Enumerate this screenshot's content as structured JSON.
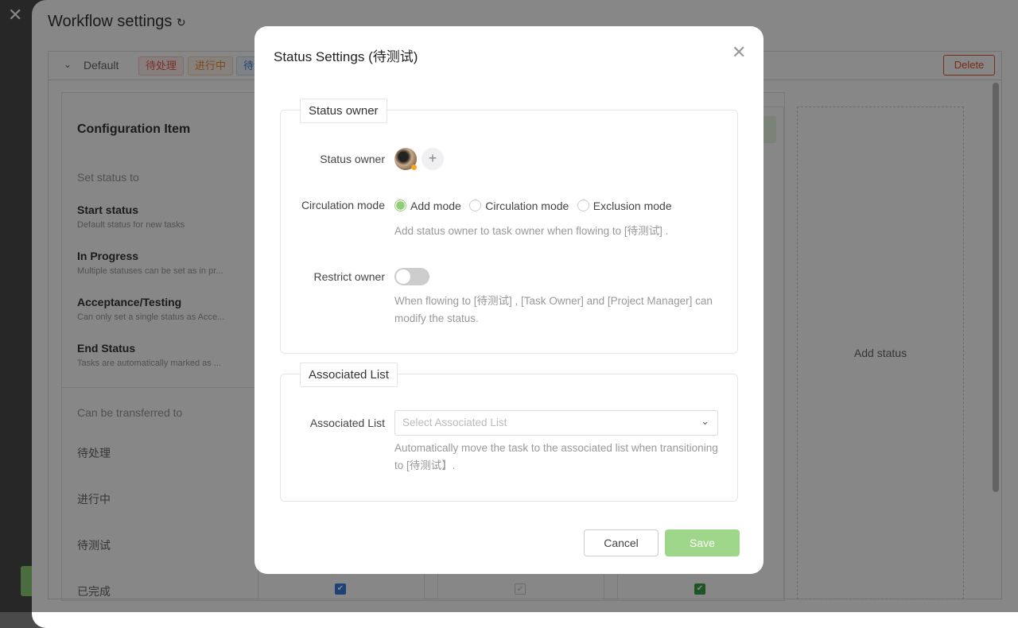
{
  "background": {
    "title": "Workflow settings",
    "workflow_name": "Default",
    "tags": [
      {
        "label": "待处理",
        "color": "#e85a4f"
      },
      {
        "label": "进行中",
        "color": "#f08a3a"
      },
      {
        "label": "待测试",
        "color": "#3a7be0"
      }
    ],
    "delete_label": "Delete",
    "config_title": "Configuration Item",
    "set_status_to": "Set status to",
    "items": [
      {
        "title": "Start status",
        "desc": "Default status for new tasks"
      },
      {
        "title": "In Progress",
        "desc": "Multiple statuses can be set as in pr..."
      },
      {
        "title": "Acceptance/Testing",
        "desc": "Can only set a single status as Acce..."
      },
      {
        "title": "End Status",
        "desc": "Tasks are automatically marked as ..."
      }
    ],
    "transfer_label": "Can be transferred to",
    "transfer_rows": [
      "待处理",
      "进行中",
      "待测试",
      "已完成"
    ],
    "add_status": "Add status"
  },
  "modal": {
    "title": "Status Settings (待测试)",
    "owner_section": "Status owner",
    "owner_label": "Status owner",
    "mode_label": "Circulation mode",
    "modes": [
      {
        "label": "Add mode",
        "selected": true
      },
      {
        "label": "Circulation mode",
        "selected": false
      },
      {
        "label": "Exclusion mode",
        "selected": false
      }
    ],
    "mode_hint": "Add status owner to task owner when flowing to [待测试] .",
    "restrict_label": "Restrict owner",
    "restrict_on": false,
    "restrict_hint": "When flowing to [待测试] , [Task Owner] and [Project Manager] can modify the status.",
    "assoc_section": "Associated List",
    "assoc_label": "Associated List",
    "assoc_placeholder": "Select Associated List",
    "assoc_hint": "Automatically move the task to the associated list when transitioning to [待测试】.",
    "cancel": "Cancel",
    "save": "Save",
    "accent": "#8fcd76"
  }
}
